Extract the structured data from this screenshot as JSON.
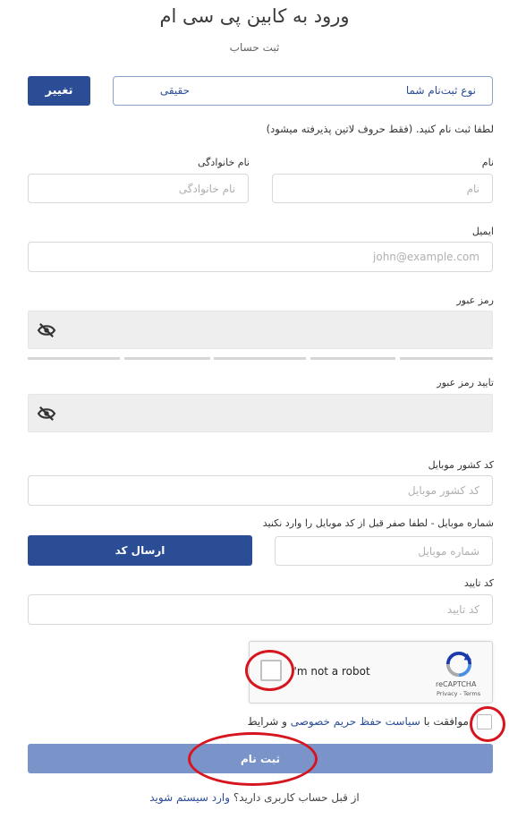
{
  "page": {
    "title": "ورود به کابین پی سی ام",
    "subtitle": "ثبت حساب"
  },
  "registration_type": {
    "label": "نوع ثبت‌نام شما",
    "value": "حقیقی",
    "change_button": "تغییر"
  },
  "hint": "لطفا ثبت نام کنید. (فقط حروف لاتین پذیرفته میشود)",
  "fields": {
    "first_name": {
      "label": "نام",
      "placeholder": "نام"
    },
    "last_name": {
      "label": "نام خانوادگی",
      "placeholder": "نام خانوادگی"
    },
    "email": {
      "label": "ایمیل",
      "placeholder": "john@example.com"
    },
    "password": {
      "label": "رمز عبور"
    },
    "password_confirm": {
      "label": "تایید رمز عبور"
    },
    "country_code": {
      "label": "کد کشور موبایل",
      "placeholder": "کد کشور موبایل"
    },
    "mobile": {
      "label": "شماره موبایل - لطفا صفر قبل از کد موبایل را وارد نکنید",
      "placeholder": "شماره موبایل",
      "send_code_button": "ارسال کد"
    },
    "verify_code": {
      "label": "کد تایید",
      "placeholder": "کد تایید"
    }
  },
  "recaptcha": {
    "text": "I'm not a robot",
    "brand": "reCAPTCHA",
    "links": "Privacy - Terms"
  },
  "consent": {
    "prefix": "موافقت با",
    "link": "سیاست حفظ حریم خصوصی",
    "suffix": "و شرایط"
  },
  "submit_button": "ثبت نام",
  "login": {
    "question": "از قبل حساب کاربری دارید؟",
    "link": "وارد سیستم شوید"
  },
  "colors": {
    "primary": "#2b4d95",
    "submit_disabled": "#7a93c8",
    "annotation": "#d6151f"
  },
  "icons": [
    "eye-off-icon",
    "recaptcha-logo-icon"
  ]
}
